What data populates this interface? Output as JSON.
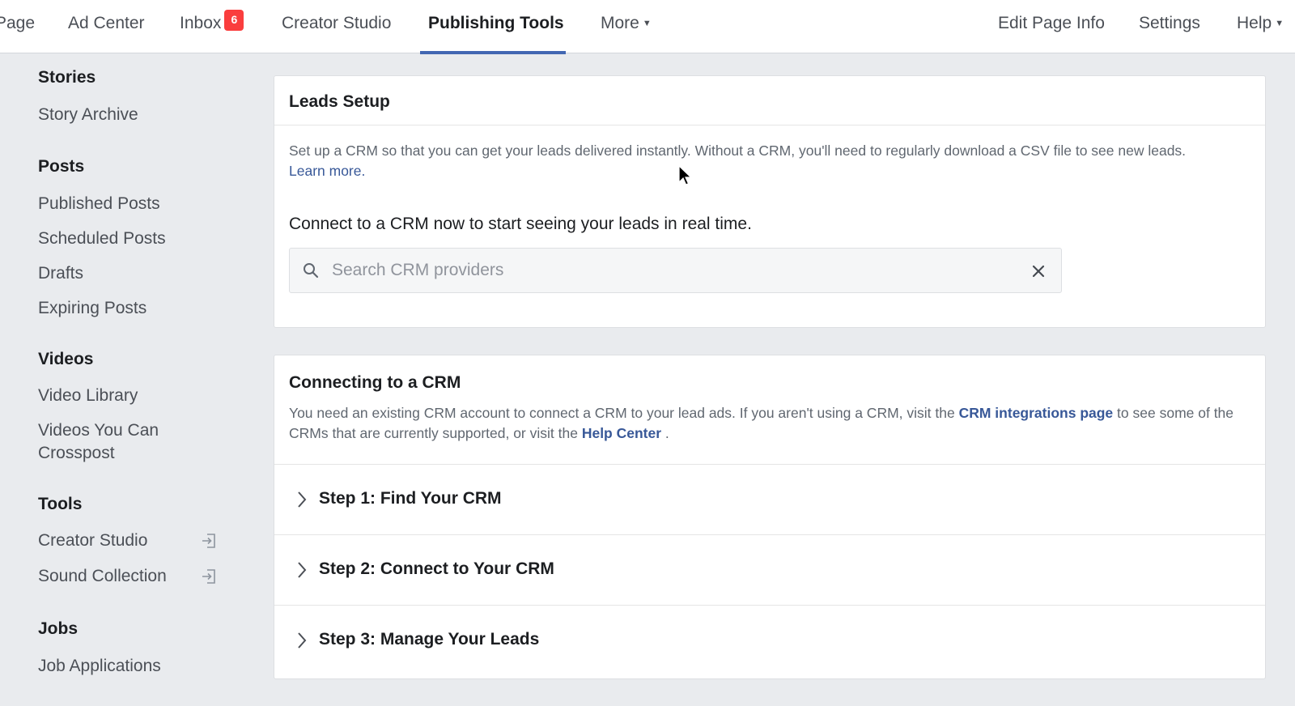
{
  "nav": {
    "left": [
      {
        "label": "Page"
      },
      {
        "label": "Ad Center"
      },
      {
        "label": "Inbox",
        "badge": "6"
      },
      {
        "label": "Creator Studio"
      },
      {
        "label": "Publishing Tools"
      },
      {
        "label": "More"
      }
    ],
    "right": [
      {
        "label": "Edit Page Info"
      },
      {
        "label": "Settings"
      },
      {
        "label": "Help"
      }
    ]
  },
  "sidebar": {
    "sections": [
      {
        "heading": "Stories",
        "items": [
          "Story Archive"
        ]
      },
      {
        "heading": "Posts",
        "items": [
          "Published Posts",
          "Scheduled Posts",
          "Drafts",
          "Expiring Posts"
        ]
      },
      {
        "heading": "Videos",
        "items": [
          "Video Library",
          "Videos You Can Crosspost"
        ]
      },
      {
        "heading": "Tools",
        "items": [
          "Creator Studio",
          "Sound Collection"
        ]
      },
      {
        "heading": "Jobs",
        "items": [
          "Job Applications"
        ]
      }
    ]
  },
  "leads_setup": {
    "title": "Leads Setup",
    "description": "Set up a CRM so that you can get your leads delivered instantly. Without a CRM, you'll need to regularly download a CSV file to see new leads.",
    "learn_more": "Learn more.",
    "connect_text": "Connect to a CRM now to start seeing your leads in real time.",
    "search_placeholder": "Search CRM providers",
    "search_value": ""
  },
  "connecting": {
    "title": "Connecting to a CRM",
    "desc_part1": "You need an existing CRM account to connect a CRM to your lead ads. If you aren't using a CRM, visit the",
    "crm_link": "CRM integrations page",
    "desc_part2": "to see some of the CRMs that are currently supported, or visit the",
    "help_link": "Help Center",
    "desc_part3": ".",
    "steps": [
      "Step 1: Find Your CRM",
      "Step 2: Connect to Your CRM",
      "Step 3: Manage Your Leads"
    ]
  },
  "colors": {
    "accent": "#4267b2",
    "badge": "#fa3e3e",
    "link": "#385898"
  }
}
